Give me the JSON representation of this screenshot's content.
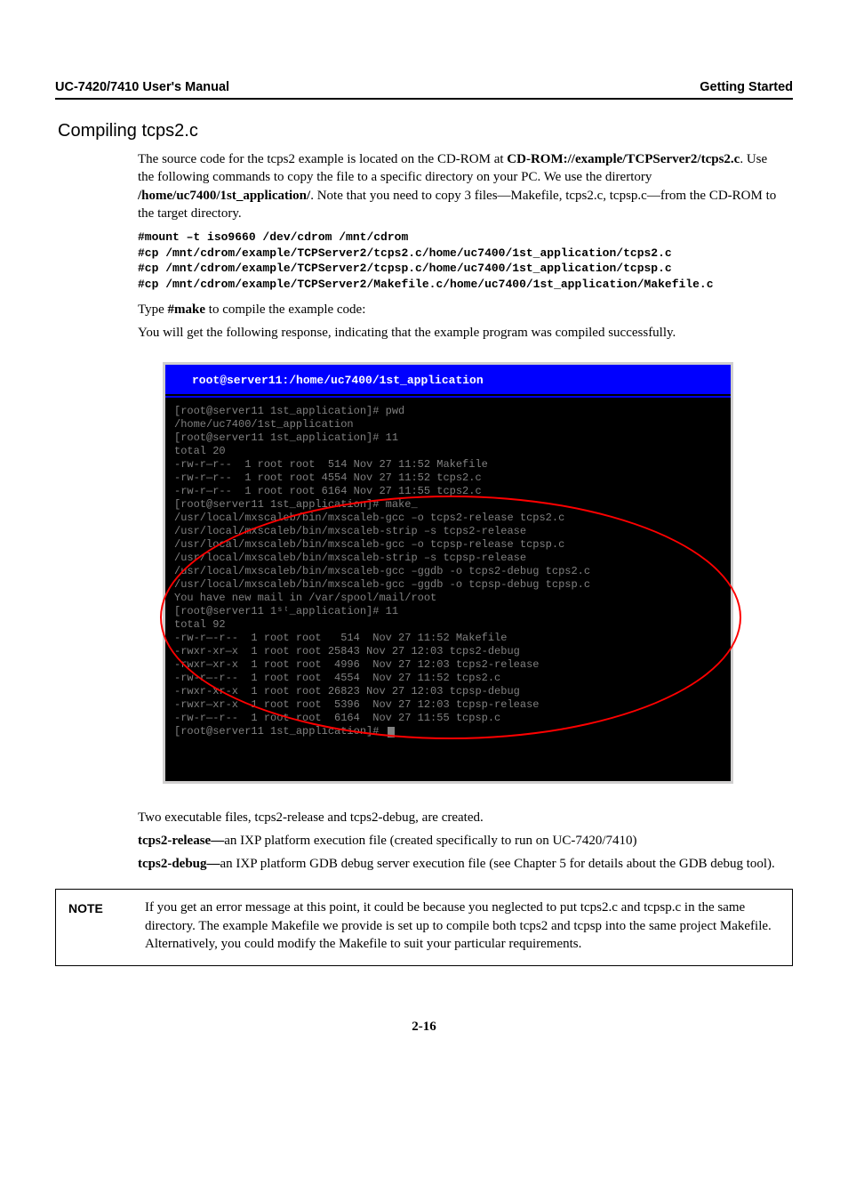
{
  "header": {
    "doc_title": "UC-7420/7410 User's Manual",
    "chapter": "Getting Started"
  },
  "section": {
    "title": "Compiling tcps2.c"
  },
  "para1_a": "The source code for the tcps2 example is located on the CD-ROM at ",
  "para1_b": "CD-ROM://example/TCPServer2/tcps2.c",
  "para1_c": ". Use the following commands to copy the file to a specific directory on your PC. We use the dirertory ",
  "para1_d": "/home/uc7400/1st_application/",
  "para1_e": ". Note that you need to copy 3 files—Makefile, tcps2.c, tcpsp.c—from the CD-ROM to the target directory.",
  "code1": "#mount –t iso9660 /dev/cdrom /mnt/cdrom\n#cp /mnt/cdrom/example/TCPServer2/tcps2.c/home/uc7400/1st_application/tcps2.c\n#cp /mnt/cdrom/example/TCPServer2/tcpsp.c/home/uc7400/1st_application/tcpsp.c\n#cp /mnt/cdrom/example/TCPServer2/Makefile.c/home/uc7400/1st_application/Makefile.c",
  "para2_a": "Type ",
  "para2_b": "#make",
  "para2_c": " to compile the example code:",
  "para3": "You will get the following response, indicating that the example program was compiled successfully.",
  "terminal": {
    "title": "root@server11:/home/uc7400/1st_application",
    "body": "[root@server11 1st_application]# pwd\n/home/uc7400/1st_application\n[root@server11 1st_application]# 11\ntotal 20\n-rw-r—r--  1 root root  514 Nov 27 11:52 Makefile\n-rw-r—r--  1 root root 4554 Nov 27 11:52 tcps2.c\n-rw-r—r--  1 root root 6164 Nov 27 11:55 tcps2.c\n[root@server11 1st_application]# make_\n/usr/local/mxscaleb/bin/mxscaleb-gcc –o tcps2-release tcps2.c\n/usr/local/mxscaleb/bin/mxscaleb-strip –s tcps2-release\n/usr/local/mxscaleb/bin/mxscaleb-gcc –o tcpsp-release tcpsp.c\n/usr/local/mxscaleb/bin/mxscaleb-strip –s tcpsp-release\n/usr/local/mxscaleb/bin/mxscaleb-gcc –ggdb -o tcps2-debug tcps2.c\n/usr/local/mxscaleb/bin/mxscaleb-gcc –ggdb -o tcpsp-debug tcpsp.c\nYou have new mail in /var/spool/mail/root\n[root@server11 1ˢᵗ_application]# 11\ntotal 92\n-rw-r—-r--  1 root root   514  Nov 27 11:52 Makefile\n-rwxr-xr—x  1 root root 25843 Nov 27 12:03 tcps2-debug\n-rwxr—xr-x  1 root root  4996  Nov 27 12:03 tcps2-release\n-rw-r—-r--  1 root root  4554  Nov 27 11:52 tcps2.c\n-rwxr-xr-x  1 root root 26823 Nov 27 12:03 tcpsp-debug\n-rwxr—xr-x  1 root root  5396  Nov 27 12:03 tcpsp-release\n-rw-r—-r--  1 root root  6164  Nov 27 11:55 tcpsp.c\n[root@server11 1st_application]# "
  },
  "para4": "Two executable files, tcps2-release and tcps2-debug, are created.",
  "para5_a": "tcps2-release—",
  "para5_b": "an IXP platform execution file (created specifically to run on UC-7420/7410)",
  "para6_a": "tcps2-debug—",
  "para6_b": "an IXP platform GDB debug server execution file (see Chapter 5 for details about the GDB debug tool).",
  "note": {
    "label": "NOTE",
    "text": "If you get an error message at this point, it could be because you neglected to put tcps2.c and tcpsp.c in the same directory. The example Makefile we provide is set up to compile both tcps2 and tcpsp into the same project Makefile. Alternatively, you could modify the Makefile to suit your particular requirements."
  },
  "page_number": "2-16"
}
